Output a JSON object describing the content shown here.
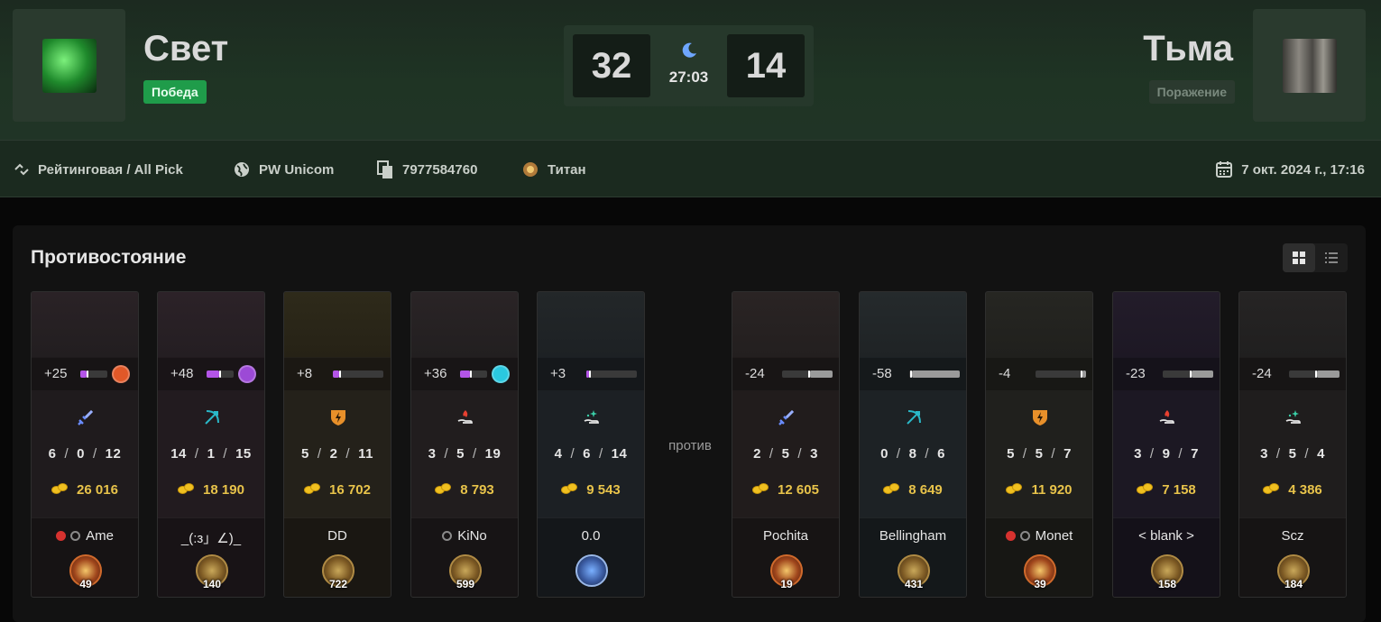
{
  "header": {
    "left_team": {
      "name": "Свет",
      "result": "Победа"
    },
    "right_team": {
      "name": "Тьма",
      "result": "Поражение"
    },
    "score_left": "32",
    "score_right": "14",
    "time": "27:03"
  },
  "info": {
    "mode": "Рейтинговая / All Pick",
    "region": "PW Unicom",
    "match_id": "7977584760",
    "rank": "Титан",
    "date": "7 окт. 2024 г., 17:16"
  },
  "panel": {
    "title": "Противостояние",
    "versus": "против"
  },
  "players": [
    {
      "mmr": "+25",
      "k": "6",
      "d": "0",
      "a": "12",
      "gold": "26 016",
      "name": "Ame",
      "rank": "49",
      "verified": true,
      "dot": true,
      "role": "sword-icon"
    },
    {
      "mmr": "+48",
      "k": "14",
      "d": "1",
      "a": "15",
      "gold": "18 190",
      "name": "_(:з」∠)_",
      "rank": "140",
      "verified": false,
      "dot": false,
      "role": "bow-icon"
    },
    {
      "mmr": "+8",
      "k": "5",
      "d": "2",
      "a": "11",
      "gold": "16 702",
      "name": "DD",
      "rank": "722",
      "verified": false,
      "dot": false,
      "role": "lightning-shield-icon"
    },
    {
      "mmr": "+36",
      "k": "3",
      "d": "5",
      "a": "19",
      "gold": "8 793",
      "name": "KiNo",
      "rank": "599",
      "verified": false,
      "dot": true,
      "role": "fire-hand-icon"
    },
    {
      "mmr": "+3",
      "k": "4",
      "d": "6",
      "a": "14",
      "gold": "9 543",
      "name": "0.0",
      "rank": "",
      "verified": false,
      "dot": false,
      "role": "sparkle-hand-icon"
    },
    {
      "mmr": "-24",
      "k": "2",
      "d": "5",
      "a": "3",
      "gold": "12 605",
      "name": "Pochita",
      "rank": "19",
      "verified": false,
      "dot": false,
      "role": "sword-icon"
    },
    {
      "mmr": "-58",
      "k": "0",
      "d": "8",
      "a": "6",
      "gold": "8 649",
      "name": "Bellingham",
      "rank": "431",
      "verified": false,
      "dot": false,
      "role": "bow-icon"
    },
    {
      "mmr": "-4",
      "k": "5",
      "d": "5",
      "a": "7",
      "gold": "11 920",
      "name": "Monet",
      "rank": "39",
      "verified": true,
      "dot": true,
      "role": "lightning-shield-icon"
    },
    {
      "mmr": "-23",
      "k": "3",
      "d": "9",
      "a": "7",
      "gold": "7 158",
      "name": "< blank >",
      "rank": "158",
      "verified": false,
      "dot": false,
      "role": "fire-hand-icon"
    },
    {
      "mmr": "-24",
      "k": "3",
      "d": "5",
      "a": "4",
      "gold": "4 386",
      "name": "Scz",
      "rank": "184",
      "verified": false,
      "dot": false,
      "role": "sparkle-hand-icon"
    }
  ],
  "colors": {
    "win": "#1f9c4a",
    "gold": "#e8c34a",
    "mmr_purple": "#b455e8",
    "mmr_grey": "#9a9a9a"
  }
}
